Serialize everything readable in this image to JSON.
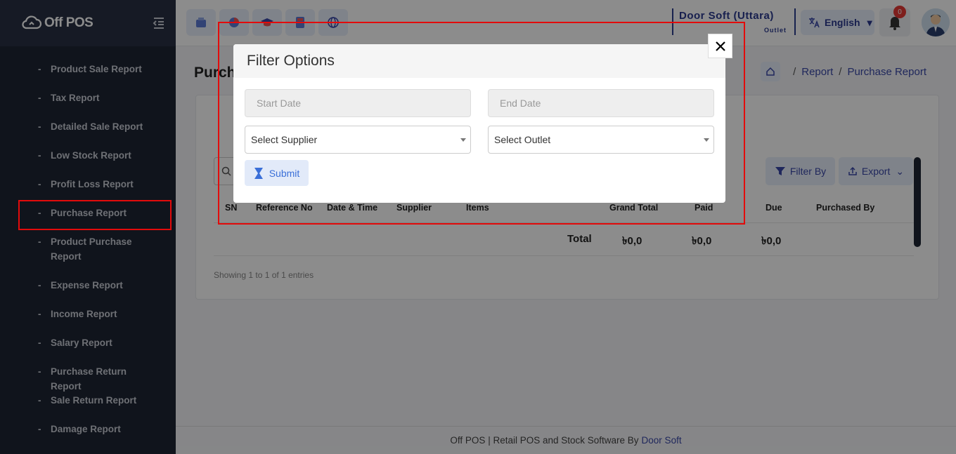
{
  "app": {
    "logo_text": "Off POS"
  },
  "sidebar": {
    "items": [
      {
        "label": "Product Sale Report"
      },
      {
        "label": "Tax Report"
      },
      {
        "label": "Detailed Sale Report"
      },
      {
        "label": "Low Stock Report"
      },
      {
        "label": "Profit Loss Report"
      },
      {
        "label": "Purchase Report"
      },
      {
        "label": "Product Purchase Report"
      },
      {
        "label": "Expense Report"
      },
      {
        "label": "Income Report"
      },
      {
        "label": "Salary Report"
      },
      {
        "label": "Purchase Return Report"
      },
      {
        "label": "Sale Return Report"
      },
      {
        "label": "Damage Report"
      }
    ],
    "active": "Purchase Report"
  },
  "topbar": {
    "store_name": "Door Soft (Uttara)",
    "store_type": "Outlet",
    "language": "English",
    "notification_count": "0",
    "quick_icons": [
      "pos-icon",
      "pie-icon",
      "cap-icon",
      "calculator-icon",
      "globe-icon"
    ]
  },
  "page": {
    "title": "Purchase Report",
    "breadcrumb": [
      "Report",
      "Purchase Report"
    ],
    "filter_label": "Filter By",
    "export_label": "Export",
    "columns": [
      "SN",
      "Reference No",
      "Date & Time",
      "Supplier",
      "Items",
      "Grand Total",
      "Paid",
      "Due",
      "Purchased By"
    ],
    "totals": {
      "label": "Total",
      "grand_total": "৳0,0",
      "paid": "৳0,0",
      "due": "৳0,0"
    },
    "showing": "Showing 1 to 1 of 1 entries"
  },
  "modal": {
    "title": "Filter Options",
    "start_date_placeholder": "Start Date",
    "end_date_placeholder": "End Date",
    "supplier_select": "Select Supplier",
    "outlet_select": "Select Outlet",
    "submit_label": "Submit"
  },
  "footer": {
    "text": "Off POS | Retail POS and Stock Software By",
    "link": "Door Soft"
  },
  "colors": {
    "accent": "#3a48a8",
    "sidebar_bg": "#1e2533",
    "highlight": "#e30b0b"
  }
}
